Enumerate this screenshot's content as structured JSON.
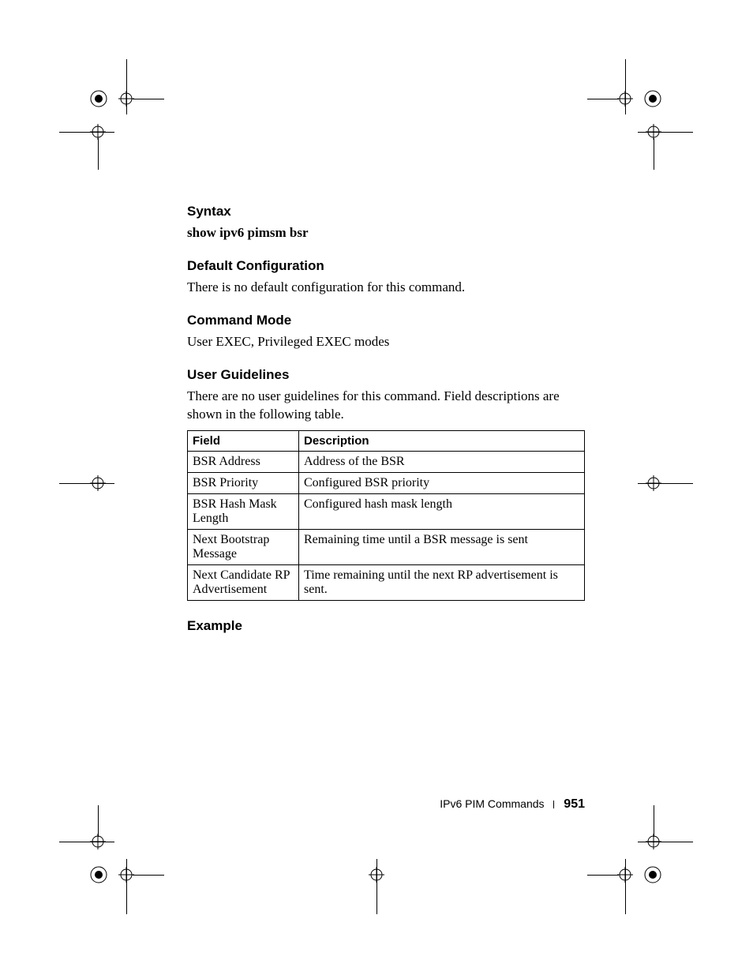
{
  "sections": {
    "syntax": {
      "heading": "Syntax",
      "body": "show ipv6 pimsm bsr"
    },
    "default_config": {
      "heading": "Default Configuration",
      "body": "There is no default configuration for this command."
    },
    "command_mode": {
      "heading": "Command Mode",
      "body": "User EXEC, Privileged EXEC modes"
    },
    "user_guidelines": {
      "heading": "User Guidelines",
      "body": "There are no user guidelines for this command. Field descriptions are shown in the following table."
    },
    "example": {
      "heading": "Example"
    }
  },
  "table": {
    "headers": {
      "field": "Field",
      "description": "Description"
    },
    "rows": [
      {
        "field": "BSR Address",
        "description": "Address of the BSR"
      },
      {
        "field": "BSR Priority",
        "description": "Configured BSR priority"
      },
      {
        "field": "BSR Hash Mask Length",
        "description": "Configured hash mask length"
      },
      {
        "field": "Next Bootstrap Message",
        "description": "Remaining time until a BSR message is sent"
      },
      {
        "field": "Next Candidate RP Advertisement",
        "description": "Time remaining until the next RP advertisement is sent."
      }
    ]
  },
  "footer": {
    "chapter": "IPv6 PIM Commands",
    "page_number": "951"
  }
}
